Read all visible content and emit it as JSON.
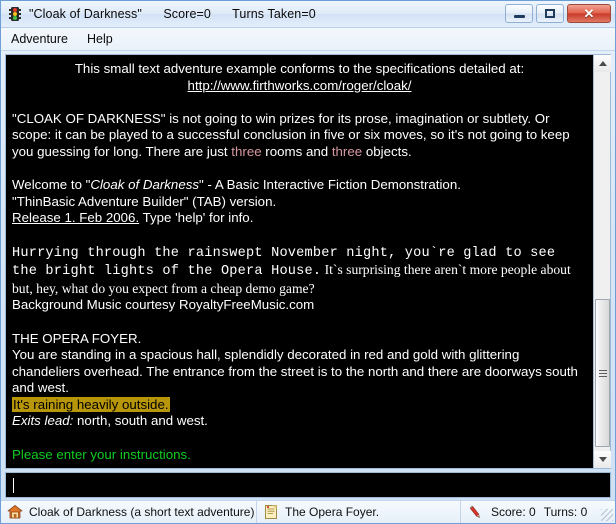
{
  "window": {
    "title": "\"Cloak of Darkness\"      Score=0      Turns Taken=0",
    "icon": "traffic-light-icon",
    "controls": {
      "minimize_label": "—",
      "maximize_label": "□",
      "close_label": "✕"
    }
  },
  "menubar": {
    "items": [
      {
        "label": "Adventure"
      },
      {
        "label": "Help"
      }
    ]
  },
  "story": {
    "intro_line1": "This small text adventure example conforms to the specifications detailed at:",
    "intro_url": "http://www.firthworks.com/roger/cloak/",
    "para2_a": "\"CLOAK OF DARKNESS\" is not going to win prizes for its prose, imagination or subtlety. Or scope: it can be played to a successful conclusion in five or six moves, so it's not going to keep you guessing for long. There are just ",
    "para2_three_1": "three",
    "para2_b": " rooms and ",
    "para2_three_2": "three",
    "para2_c": " objects.",
    "welcome_a": "Welcome to \"",
    "welcome_title": "Cloak of Darkness",
    "welcome_b": "\" - A Basic Interactive Fiction Demonstration.",
    "version_line": "\"ThinBasic Adventure Builder\" (TAB) version.",
    "release_underlined": "Release 1. Feb 2006.",
    "release_rest": " Type 'help' for info.",
    "mono_block": "Hurrying through the rainswept November night, you`re glad to see the bright lights of the Opera House.",
    "serif_block": " It`s surprising there aren`t more people about but, hey, what do you expect from a cheap demo game?",
    "music_credit": "Background Music courtesy RoyaltyFreeMusic.com",
    "room_title": "THE OPERA FOYER.",
    "room_desc": "You are standing in a spacious hall, splendidly decorated in red and gold with glittering chandeliers overhead. The entrance from the street is to the north and there are doorways south and west.",
    "weather_highlight": "It's raining heavily outside.",
    "exits_label": "Exits lead:",
    "exits_value": " north, south and west.",
    "prompt": "Please enter your instructions."
  },
  "command": {
    "value": "",
    "placeholder": ""
  },
  "statusbar": {
    "game_icon": "house-icon",
    "game_label": "Cloak of Darkness (a short text adventure)",
    "room_icon": "notepad-icon",
    "room_label": "The Opera Foyer.",
    "stats_icon": "pencil-icon",
    "score_label": "Score:  0",
    "turns_label": "Turns:  0"
  },
  "scrollbar": {
    "up_arrow": "scroll-up-arrow",
    "down_arrow": "scroll-down-arrow"
  },
  "colors": {
    "story_bg": "#000000",
    "story_fg": "#ffffff",
    "highlight_bg": "#b8960a",
    "prompt_green": "#11cc22",
    "accent_rose": "#d79aa0",
    "frame_blue": "#6d9ed6"
  }
}
